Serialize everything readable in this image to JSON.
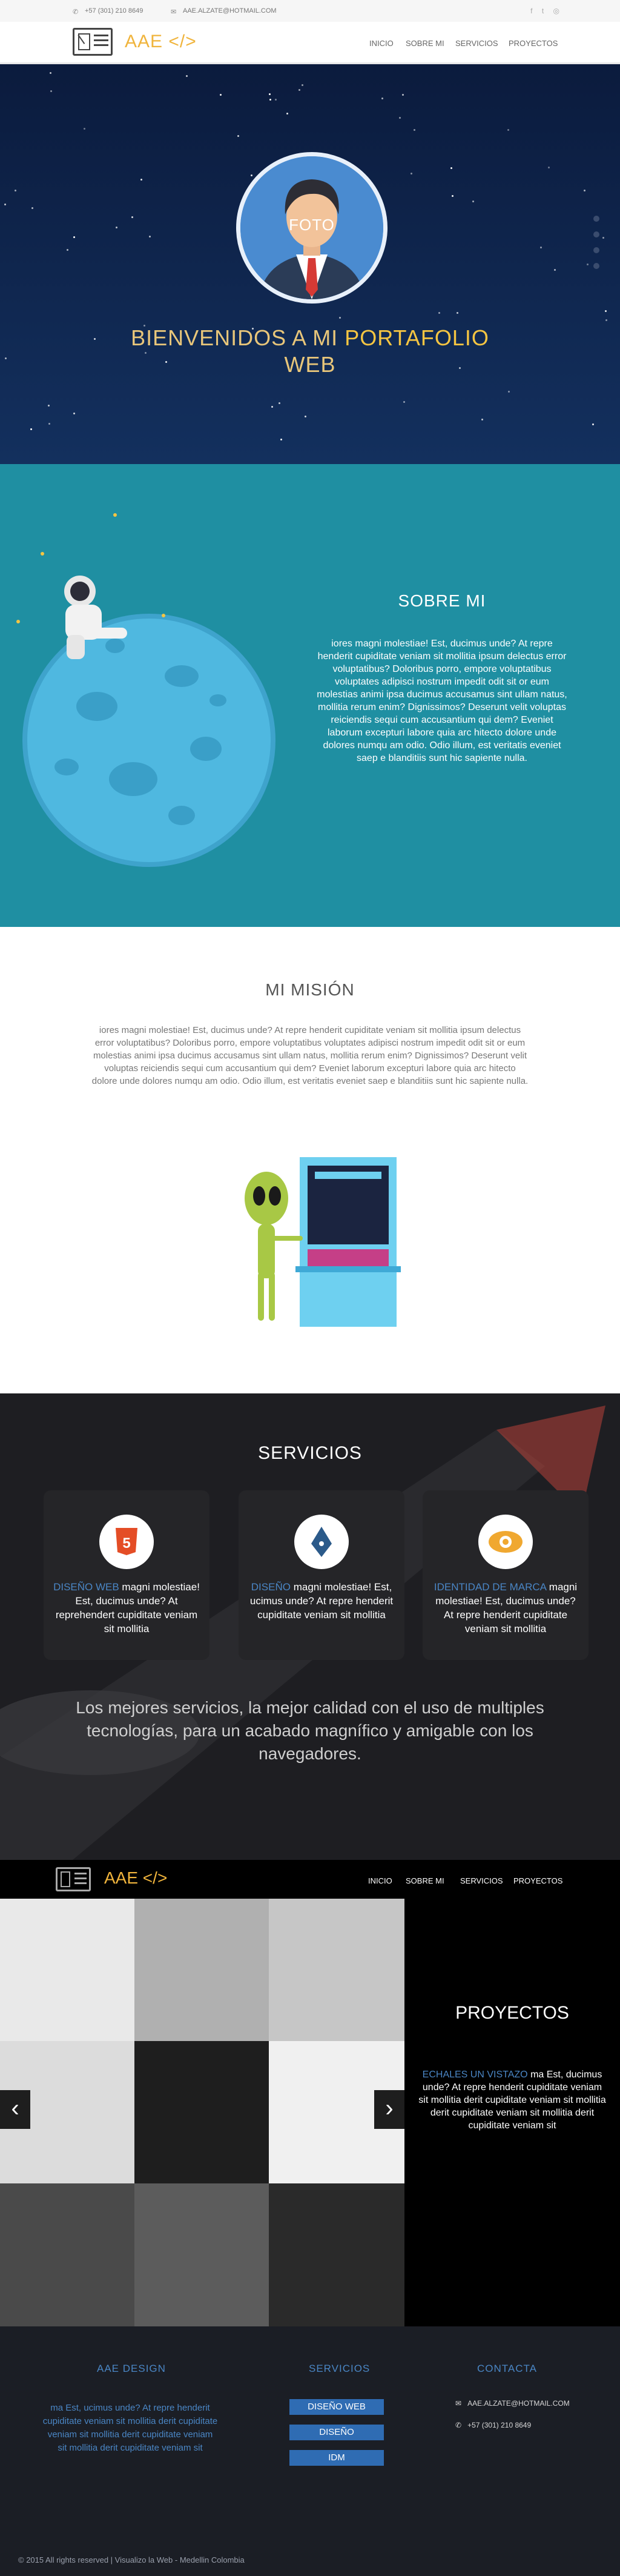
{
  "topbar": {
    "phone": "+57 (301) 210 8649",
    "email": "AAE.ALZATE@HOTMAIL.COM",
    "social": [
      "f",
      "t",
      "◎"
    ]
  },
  "brand": {
    "name": "AAE </>"
  },
  "nav": [
    "INICIO",
    "SOBRE MI",
    "SERVICIOS",
    "PROYECTOS"
  ],
  "hero": {
    "avatar_label": "FOTO",
    "title_prefix": "BIENVENIDOS A MI ",
    "title_highlight": "PORTAFOLIO",
    "title_suffix": "WEB"
  },
  "about": {
    "title": "SOBRE MI",
    "text": "iores magni molestiae! Est, ducimus unde? At repre henderit cupiditate veniam sit mollitia ipsum delectus error voluptatibus? Doloribus porro, empore voluptatibus voluptates adipisci nostrum impedit odit sit or eum molestias animi ipsa ducimus accusamus sint ullam natus, mollitia rerum enim? Dignissimos? Deserunt velit voluptas reiciendis sequi cum accusantium qui dem? Eveniet laborum excepturi labore quia arc hitecto dolore unde dolores numqu am odio. Odio illum, est veritatis eveniet saep e blanditiis sunt hic sapiente nulla."
  },
  "mission": {
    "title": "MI MISIÓN",
    "text": "iores magni molestiae! Est, ducimus unde? At repre henderit cupiditate veniam sit mollitia ipsum delectus error voluptatibus? Doloribus porro, empore voluptatibus voluptates adipisci nostrum impedit odit sit or eum molestias animi ipsa ducimus accusamus sint ullam natus, mollitia rerum enim? Dignissimos? Deserunt velit voluptas reiciendis sequi cum accusantium qui dem? Eveniet laborum excepturi labore quia arc hitecto dolore unde dolores numqu am odio. Odio illum, est veritatis eveniet saep e blanditiis sunt hic sapiente nulla."
  },
  "services": {
    "title": "SERVICIOS",
    "cards": [
      {
        "icon": "html5-icon",
        "label": "DISEÑO WEB",
        "text": "magni molestiae! Est, ducimus unde? At reprehendert cupiditate veniam sit mollitia"
      },
      {
        "icon": "pen-nib-icon",
        "label": "DISEÑO",
        "text": "magni molestiae! Est, ucimus unde? At repre henderit cupiditate veniam sit mollitia"
      },
      {
        "icon": "eye-icon",
        "label": "IDENTIDAD DE MARCA",
        "text": "magni molestiae! Est, ducimus unde? At repre henderit cupiditate veniam sit mollitia"
      }
    ],
    "claim": "Los mejores servicios, la mejor calidad con el uso de multiples tecnologías, para un acabado magnífico y amigable con los navegadores."
  },
  "projects": {
    "title": "PROYECTOS",
    "highlight": "ECHALES UN VISTAZO",
    "text": " ma Est, ducimus unde? At repre henderit cupiditate veniam sit mollitia derit cupiditate veniam sit mollitia derit cupiditate veniam sit mollitia derit cupiditate veniam sit",
    "tiles": [
      "#e9e9e9",
      "#b0b0b0",
      "#c6c6c6",
      "#dcdcdc",
      "#1e1e1e",
      "#f0f0f0",
      "#4a4a4a",
      "#5c5c5c",
      "#2a2a2a"
    ],
    "prev": "‹",
    "next": "›"
  },
  "footer": {
    "col1_title": "AAE DESIGN",
    "col1_text": "ma Est, ucimus unde? At repre henderit cupiditate veniam sit mollitia derit cupiditate veniam sit mollitia derit cupiditate veniam sit mollitia derit cupiditate veniam sit",
    "col2_title": "SERVICIOS",
    "col2_buttons": [
      "DISEÑO WEB",
      "DISEÑO",
      "IDM"
    ],
    "col3_title": "CONTACTA",
    "email": "AAE.ALZATE@HOTMAIL.COM",
    "phone": "+57 (301) 210 8649",
    "copyright": "© 2015 All rights reserved | Visualizo la Web - Medellin Colombia"
  },
  "colors": {
    "accent": "#f5c542",
    "link": "#4a86c5",
    "about_bg": "#1f8fa2",
    "hero_bg": "#0b1b3d"
  }
}
